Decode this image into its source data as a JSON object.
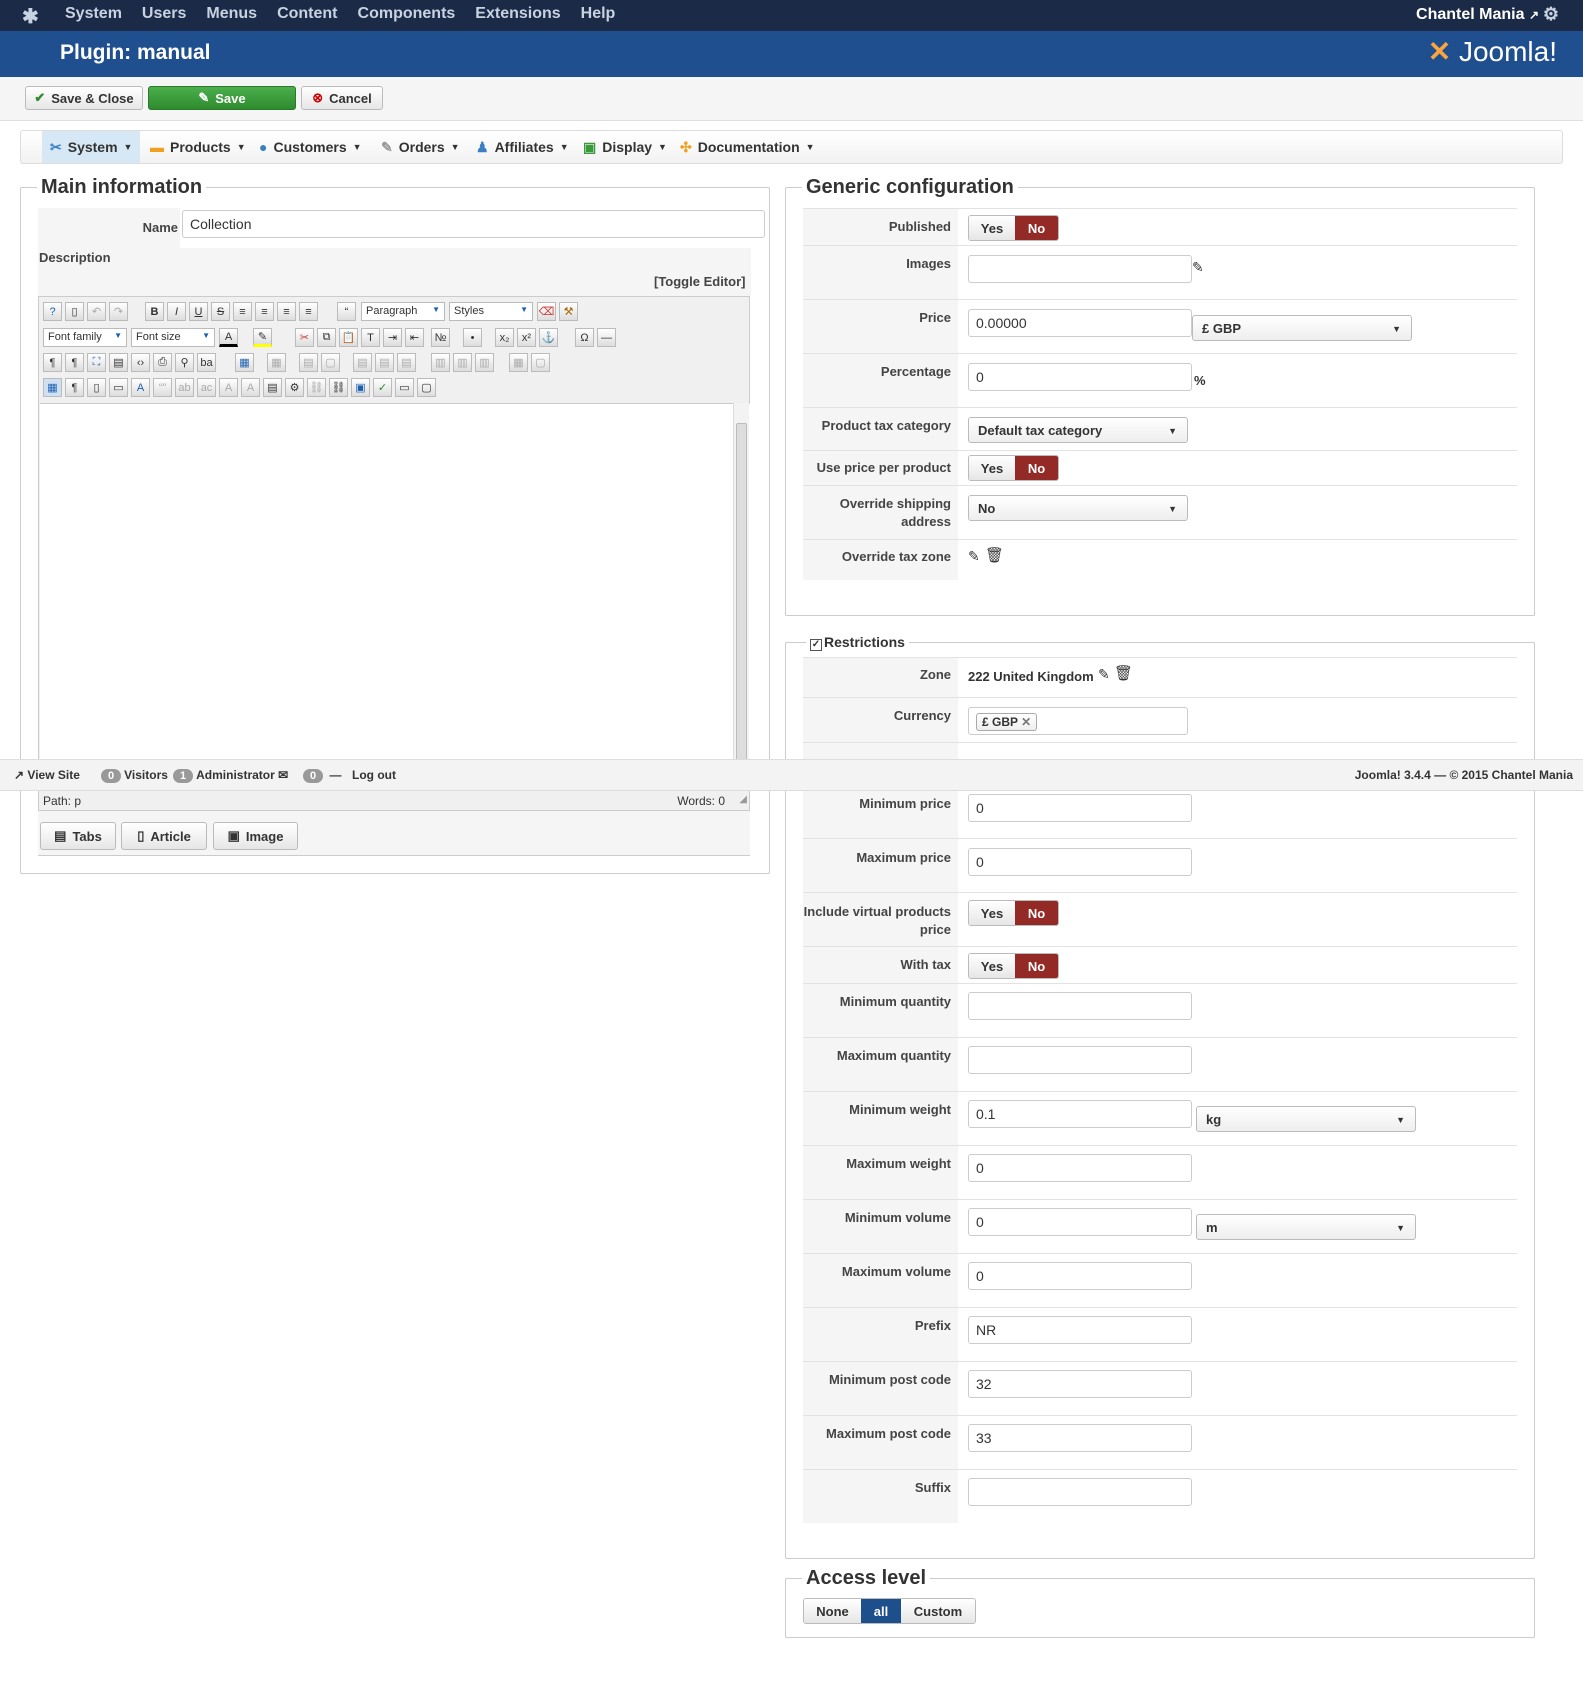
{
  "topbar": {
    "menu": [
      "System",
      "Users",
      "Menus",
      "Content",
      "Components",
      "Extensions",
      "Help"
    ],
    "site_name": "Chantel Mania"
  },
  "header": {
    "title": "Plugin: manual",
    "brand": "Joomla!"
  },
  "toolbar": {
    "save_close": "Save & Close",
    "save": "Save",
    "cancel": "Cancel"
  },
  "nav": {
    "items": [
      "System",
      "Products",
      "Customers",
      "Orders",
      "Affiliates",
      "Display",
      "Documentation"
    ]
  },
  "main": {
    "legend": "Main information",
    "name_label": "Name",
    "name_value": "Collection",
    "description_label": "Description",
    "toggle_editor": "[Toggle Editor]",
    "editor": {
      "paragraph": "Paragraph",
      "styles": "Styles",
      "font_family": "Font family",
      "font_size": "Font size",
      "path": "Path:  p",
      "words": "Words: 0"
    },
    "buttons": [
      "Tabs",
      "Article",
      "Image"
    ]
  },
  "generic": {
    "legend": "Generic configuration",
    "published": "Published",
    "images": "Images",
    "price": "Price",
    "price_value": "0.00000",
    "currency": "£ GBP",
    "percentage": "Percentage",
    "percentage_value": "0",
    "percent_sign": "%",
    "tax_category": "Product tax category",
    "tax_category_value": "Default tax category",
    "use_price_per_product": "Use price per product",
    "override_shipping": "Override shipping address",
    "override_shipping_value": "No",
    "override_tax_zone": "Override tax zone",
    "yes": "Yes",
    "no": "No"
  },
  "restrictions": {
    "legend": "Restrictions",
    "zone": "Zone",
    "zone_value": "222 United Kingdom",
    "currency": "Currency",
    "currency_tag": "£ GBP",
    "min_price": "Minimum price",
    "min_price_value": "0",
    "max_price": "Maximum price",
    "max_price_value": "0",
    "include_virtual": "Include virtual products price",
    "with_tax": "With tax",
    "min_qty": "Minimum quantity",
    "max_qty": "Maximum quantity",
    "min_weight": "Minimum weight",
    "min_weight_value": "0.1",
    "weight_unit": "kg",
    "max_weight": "Maximum weight",
    "max_weight_value": "0",
    "min_volume": "Minimum volume",
    "min_volume_value": "0",
    "volume_unit": "m",
    "max_volume": "Maximum volume",
    "max_volume_value": "0",
    "prefix": "Prefix",
    "prefix_value": "NR",
    "min_post": "Minimum post code",
    "min_post_value": "32",
    "max_post": "Maximum post code",
    "max_post_value": "33",
    "suffix": "Suffix"
  },
  "access": {
    "legend": "Access level",
    "options": [
      "None",
      "all",
      "Custom"
    ]
  },
  "status": {
    "view_site": "View Site",
    "visitors_count": "0",
    "visitors": "Visitors",
    "admin_count": "1",
    "admin": "Administrator",
    "msg_count": "0",
    "logout": "Log out",
    "version": "Joomla! 3.4.4  —  © 2015 Chantel Mania"
  }
}
